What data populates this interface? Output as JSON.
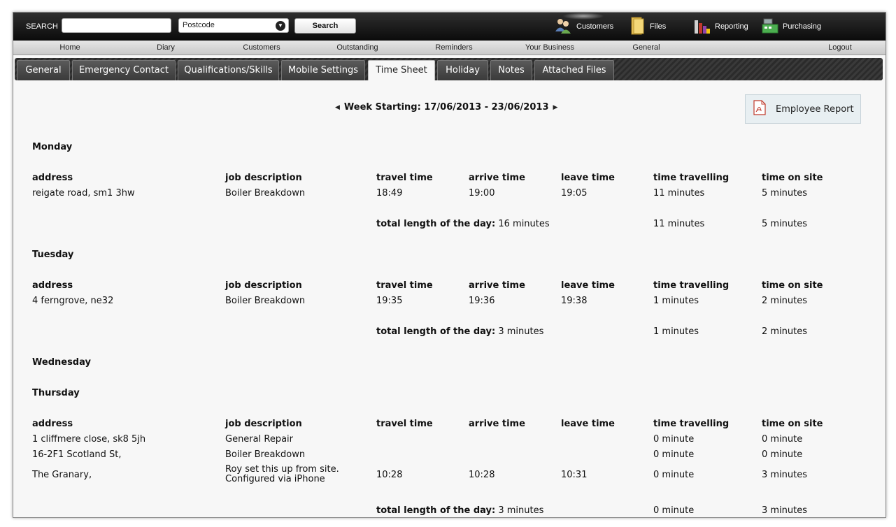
{
  "search": {
    "label": "SEARCH",
    "value": "",
    "postcode_selected": "Postcode",
    "button": "Search"
  },
  "topnav": {
    "customers": "Customers",
    "files": "Files",
    "reporting": "Reporting",
    "purchasing": "Purchasing"
  },
  "menu": [
    "Home",
    "Diary",
    "Customers",
    "Outstanding",
    "Reminders",
    "Your Business",
    "General",
    "Logout"
  ],
  "tabs": [
    "General",
    "Emergency Contact",
    "Qualifications/Skills",
    "Mobile Settings",
    "Time Sheet",
    "Holiday",
    "Notes",
    "Attached Files"
  ],
  "week_label": "Week Starting: 17/06/2013 - 23/06/2013",
  "employee_report": "Employee Report",
  "headers": {
    "address": "address",
    "job": "job description",
    "travel": "travel time",
    "arrive": "arrive time",
    "leave": "leave time",
    "travelling": "time travelling",
    "onsite": "time on site"
  },
  "total_label": "total length of the day:",
  "days": [
    {
      "name": "Monday",
      "rows": [
        {
          "address": "reigate road, sm1 3hw",
          "job": "Boiler Breakdown",
          "travel": "18:49",
          "arrive": "19:00",
          "leave": "19:05",
          "travelling": "11 minutes",
          "onsite": "5 minutes"
        }
      ],
      "total": {
        "length": "16 minutes",
        "travelling": "11 minutes",
        "onsite": "5 minutes"
      }
    },
    {
      "name": "Tuesday",
      "rows": [
        {
          "address": "4 ferngrove, ne32",
          "job": "Boiler Breakdown",
          "travel": "19:35",
          "arrive": "19:36",
          "leave": "19:38",
          "travelling": "1 minutes",
          "onsite": "2 minutes"
        }
      ],
      "total": {
        "length": "3 minutes",
        "travelling": "1 minutes",
        "onsite": "2 minutes"
      }
    },
    {
      "name": "Wednesday",
      "rows": []
    },
    {
      "name": "Thursday",
      "rows": [
        {
          "address": "1 cliffmere close, sk8 5jh",
          "job": "General Repair",
          "travel": "",
          "arrive": "",
          "leave": "",
          "travelling": "0 minute",
          "onsite": "0 minute"
        },
        {
          "address": "16-2F1 Scotland St,",
          "job": "Boiler Breakdown",
          "travel": "",
          "arrive": "",
          "leave": "",
          "travelling": "0 minute",
          "onsite": "0 minute"
        },
        {
          "address": "The Granary,",
          "job_line1": "Roy set this up from site.",
          "job_line2": "Configured via iPhone",
          "travel": "10:28",
          "arrive": "10:28",
          "leave": "10:31",
          "travelling": "0 minute",
          "onsite": "3 minutes"
        }
      ],
      "total": {
        "length": "3 minutes",
        "travelling": "0 minute",
        "onsite": "3 minutes"
      }
    }
  ]
}
